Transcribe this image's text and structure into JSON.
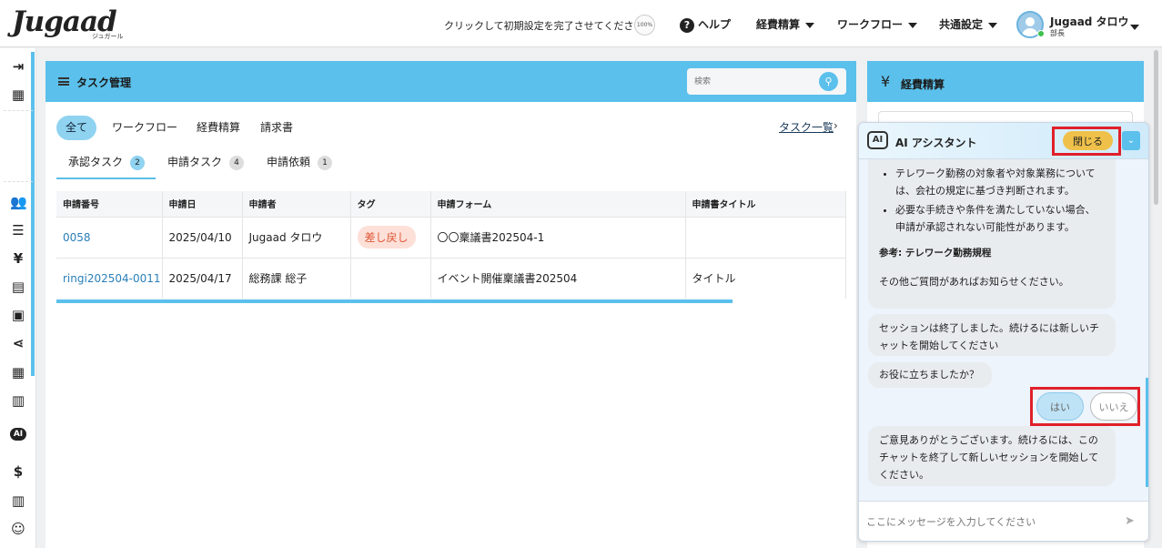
{
  "brand": {
    "logo": "Jugaad",
    "logo_sub": "ジュガール"
  },
  "header": {
    "setup_message": "クリックして初期設定を完了させてください →",
    "setup_progress": "100%",
    "help": "ヘルプ",
    "nav": [
      "経費精算",
      "ワークフロー",
      "共通設定"
    ],
    "user_name": "Jugaad タロウ",
    "user_role": "部長"
  },
  "sidebar": {
    "icons": [
      "sidebar-toggle-icon",
      "building-icon",
      "users-icon",
      "list-icon",
      "yen-icon",
      "receipt-icon",
      "document-icon",
      "share-icon",
      "grid-icon",
      "book-icon",
      "ai-chat-icon",
      "invoice-icon",
      "manual-icon",
      "support-icon"
    ]
  },
  "tasks": {
    "title": "タスク管理",
    "search_placeholder": "検索",
    "filters": [
      "全て",
      "ワークフロー",
      "経費精算",
      "請求書"
    ],
    "task_list_link": "タスク一覧",
    "subtabs": [
      {
        "label": "承認タスク",
        "count": "2"
      },
      {
        "label": "申請タスク",
        "count": "4"
      },
      {
        "label": "申請依頼",
        "count": "1"
      }
    ],
    "columns": [
      "申請番号",
      "申請日",
      "申請者",
      "タグ",
      "申請フォーム",
      "申請書タイトル"
    ],
    "rows": [
      {
        "id": "0058",
        "date": "2025/04/10",
        "applicant": "Jugaad タロウ",
        "tag": "差し戻し",
        "form": "〇〇稟議書202504-1",
        "title": ""
      },
      {
        "id": "ringi202504-0011",
        "date": "2025/04/17",
        "applicant": "総務課 総子",
        "tag": "",
        "form": "イベント開催稟議書202504",
        "title": "タイトル"
      }
    ]
  },
  "expense": {
    "title": "経費精算"
  },
  "assistant": {
    "icon_text": "AI",
    "title": "AI アシスタント",
    "close_label": "閉じる",
    "message1": {
      "bullets": [
        "テレワーク勤務の対象者や対象業務については、会社の規定に基づき判断されます。",
        "必要な手続きや条件を満たしていない場合、申請が承認されない可能性があります。"
      ],
      "reference": "参考: テレワーク勤務規程",
      "closing": "その他ご質問があればお知らせください。"
    },
    "message2": "セッションは終了しました。続けるには新しいチャットを開始してください",
    "message3": "お役に立ちましたか？",
    "yes": "はい",
    "no": "いいえ",
    "message4": "ご意見ありがとうございます。続けるには、このチャットを終了して新しいセッションを開始してください。",
    "input_placeholder": "ここにメッセージを入力してください"
  },
  "colors": {
    "accent": "#5bc0eb",
    "highlight": "#e0202a",
    "close_button": "#efc14a",
    "tag_bg": "#fde0d8"
  }
}
